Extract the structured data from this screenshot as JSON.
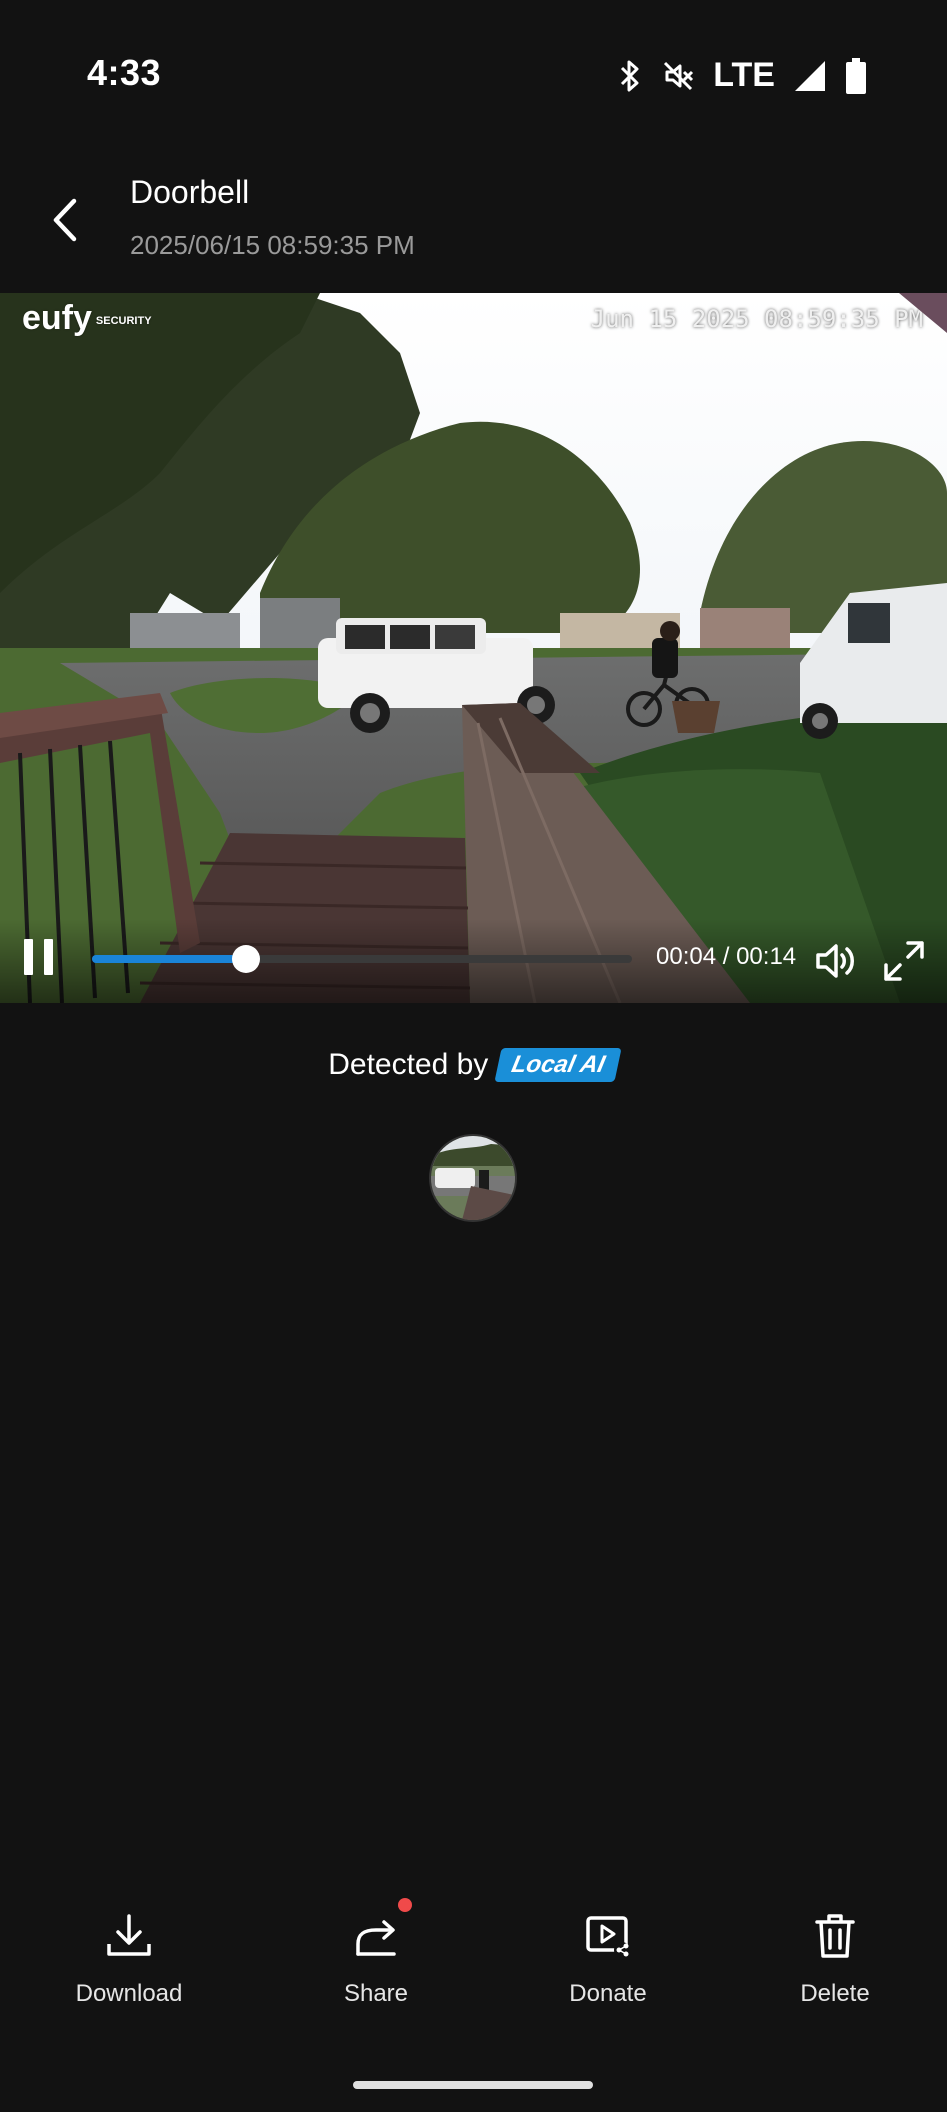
{
  "status_bar": {
    "time": "4:33",
    "network": "LTE",
    "icons": [
      "bluetooth-icon",
      "mute-icon",
      "signal-icon",
      "battery-icon"
    ]
  },
  "header": {
    "title": "Doorbell",
    "subtitle": "2025/06/15 08:59:35 PM"
  },
  "video": {
    "watermark_brand": "eufy",
    "watermark_sub": "SECURITY",
    "osd_timestamp": "Jun 15 2025  08:59:35 PM",
    "time_current": "00:04",
    "time_separator": " / ",
    "time_total": "00:14",
    "progress_fraction": 0.286,
    "colors": {
      "progress_fill": "#1a84d8",
      "progress_track": "#3a3a3a"
    }
  },
  "detection": {
    "label": "Detected by",
    "badge": "Local AI",
    "badge_color": "#1a8fd8"
  },
  "actions": [
    {
      "label": "Download",
      "icon": "download-icon"
    },
    {
      "label": "Share",
      "icon": "share-icon",
      "notification": true
    },
    {
      "label": "Donate",
      "icon": "donate-video-icon"
    },
    {
      "label": "Delete",
      "icon": "trash-icon"
    }
  ]
}
